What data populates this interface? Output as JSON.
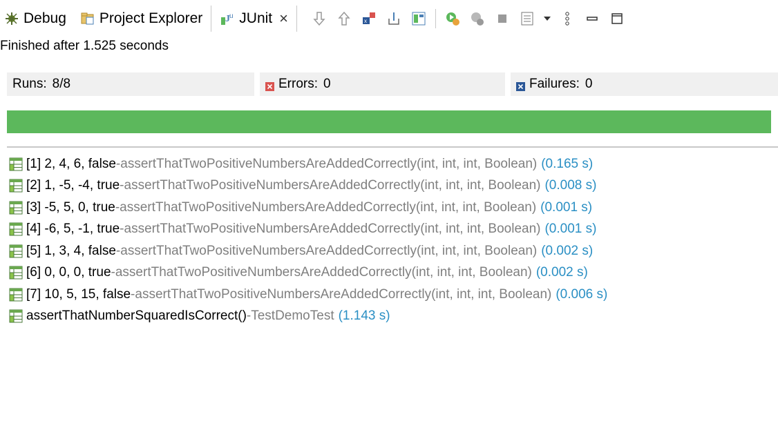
{
  "tabs": [
    {
      "label": "Debug",
      "icon": "debug-icon"
    },
    {
      "label": "Project Explorer",
      "icon": "project-explorer-icon"
    },
    {
      "label": "JUnit",
      "icon": "junit-icon",
      "close": "×"
    }
  ],
  "status_text": "Finished after 1.525 seconds",
  "counters": {
    "runs_label": "Runs:",
    "runs_value": "8/8",
    "errors_label": "Errors:",
    "errors_value": "0",
    "failures_label": "Failures:",
    "failures_value": "0"
  },
  "progress": {
    "fraction": 1.0,
    "color": "#5cb85c"
  },
  "results": [
    {
      "name": "[1] 2, 4, 6, false",
      "sep": " - ",
      "method": "assertThatTwoPositiveNumbersAreAddedCorrectly(int, int, int, Boolean)",
      "time": "(0.165 s)"
    },
    {
      "name": "[2] 1, -5, -4, true",
      "sep": " - ",
      "method": "assertThatTwoPositiveNumbersAreAddedCorrectly(int, int, int, Boolean)",
      "time": "(0.008 s)"
    },
    {
      "name": "[3] -5, 5, 0, true",
      "sep": " - ",
      "method": "assertThatTwoPositiveNumbersAreAddedCorrectly(int, int, int, Boolean)",
      "time": "(0.001 s)"
    },
    {
      "name": "[4] -6, 5, -1, true",
      "sep": " - ",
      "method": "assertThatTwoPositiveNumbersAreAddedCorrectly(int, int, int, Boolean)",
      "time": "(0.001 s)"
    },
    {
      "name": "[5] 1, 3, 4, false",
      "sep": " - ",
      "method": "assertThatTwoPositiveNumbersAreAddedCorrectly(int, int, int, Boolean)",
      "time": "(0.002 s)"
    },
    {
      "name": "[6] 0, 0, 0, true",
      "sep": " - ",
      "method": "assertThatTwoPositiveNumbersAreAddedCorrectly(int, int, int, Boolean)",
      "time": "(0.002 s)"
    },
    {
      "name": "[7] 10, 5, 15, false",
      "sep": " - ",
      "method": "assertThatTwoPositiveNumbersAreAddedCorrectly(int, int, int, Boolean)",
      "time": "(0.006 s)"
    },
    {
      "name": "assertThatNumberSquaredIsCorrect()",
      "sep": " - ",
      "method": "TestDemoTest",
      "time": "(1.143 s)"
    }
  ],
  "colors": {
    "pass": "#5cb85c",
    "error": "#d9534f",
    "failure": "#2b5797",
    "time": "#2a8fc4"
  }
}
